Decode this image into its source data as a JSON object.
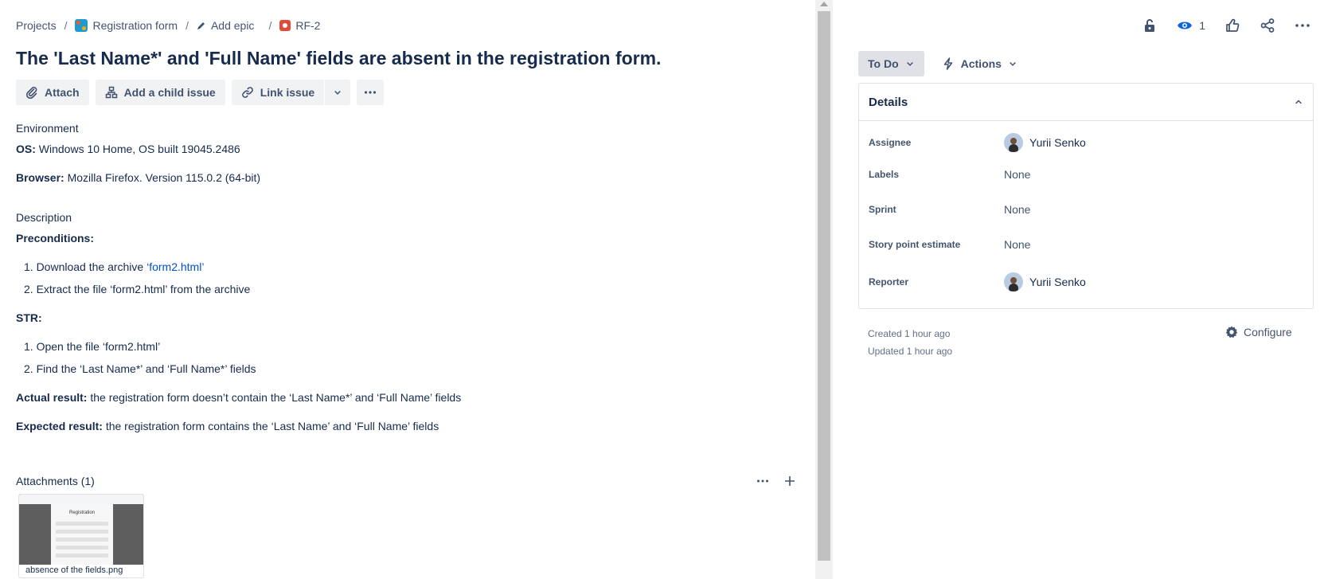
{
  "breadcrumb": {
    "projects": "Projects",
    "project": "Registration form",
    "epic": "Add epic",
    "issue_key": "RF-2"
  },
  "issue": {
    "title": "The 'Last Name*' and 'Full Name' fields are absent in the registration form."
  },
  "toolbar": {
    "attach": "Attach",
    "add_child": "Add a child issue",
    "link_issue": "Link issue"
  },
  "environment": {
    "label": "Environment",
    "os_label": "OS:",
    "os_value": " Windows 10 Home, OS built 19045.2486",
    "browser_label": "Browser:",
    "browser_value": " Mozilla Firefox. Version 115.0.2 (64-bit)"
  },
  "description": {
    "label": "Description",
    "preconditions_label": "Preconditions:",
    "pre1_text": "1. Download the archive ",
    "pre1_link": "‘form2.html’",
    "pre2": "2. Extract the file ‘form2.html’ from the archive",
    "str_label": "STR:",
    "str1": "1. Open the file ‘form2.html’",
    "str2": "2. Find the ‘Last Name*’ and ‘Full Name*’ fields",
    "actual_label": "Actual result:",
    "actual_value": " the registration form doesn’t contain the ‘Last Name*’ and ‘Full Name’ fields",
    "expected_label": "Expected result:",
    "expected_value": " the registration form contains the ‘Last Name’ and ‘Full Name’ fields"
  },
  "attachments": {
    "label": "Attachments (1)",
    "file_name": "absence of the fields.png",
    "thumb_title": "Registration"
  },
  "top": {
    "watch_count": "1"
  },
  "status": {
    "current": "To Do",
    "actions": "Actions"
  },
  "details": {
    "header": "Details",
    "assignee_label": "Assignee",
    "assignee": "Yurii Senko",
    "labels_label": "Labels",
    "labels": "None",
    "sprint_label": "Sprint",
    "sprint": "None",
    "story_points_label": "Story point estimate",
    "story_points": "None",
    "reporter_label": "Reporter",
    "reporter": "Yurii Senko"
  },
  "meta": {
    "created": "Created 1 hour ago",
    "updated": "Updated 1 hour ago",
    "configure": "Configure"
  }
}
